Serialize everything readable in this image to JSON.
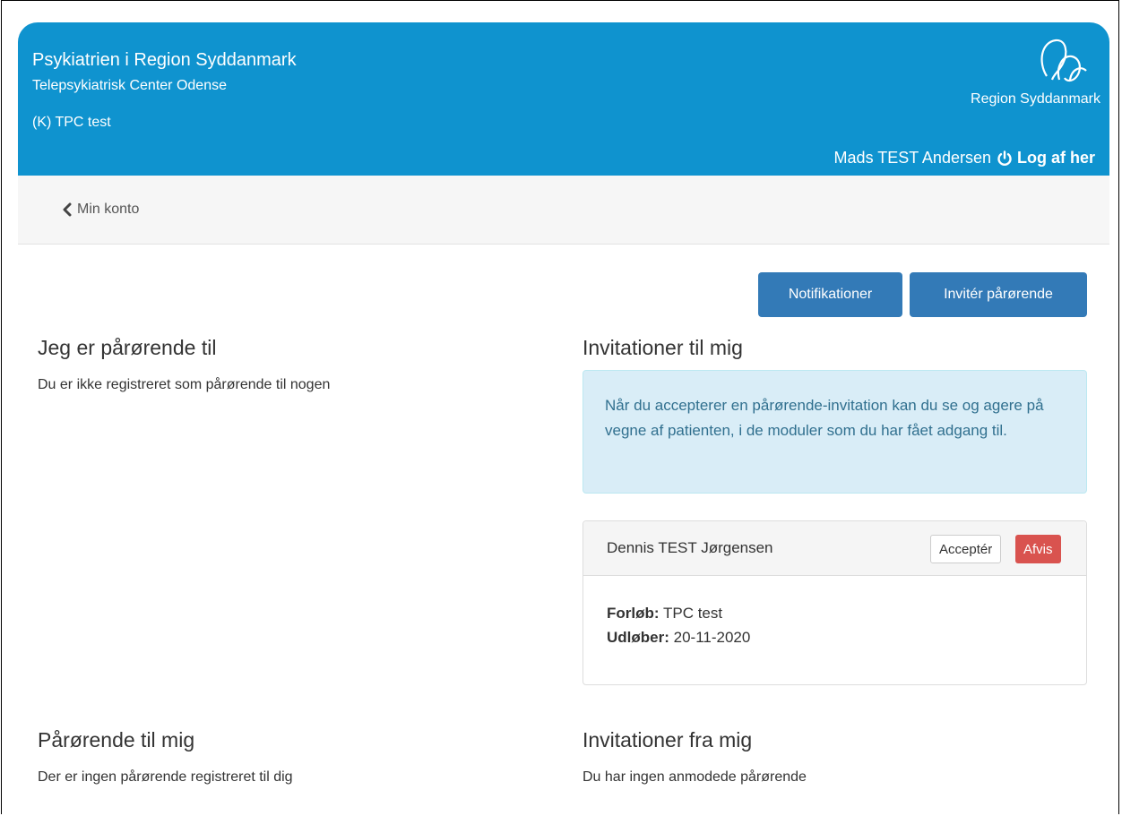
{
  "header": {
    "org_name": "Psykiatrien i Region Syddanmark",
    "org_sub": "Telepsykiatrisk Center Odense",
    "course": "(K) TPC test",
    "logo_text": "Region Syddanmark",
    "user_name": "Mads TEST Andersen",
    "logout_label": "Log af her",
    "background_color": "#0f93cf"
  },
  "subnav": {
    "back_label": "Min konto"
  },
  "actions": {
    "notifications_label": "Notifikationer",
    "invite_label": "Invitér pårørende",
    "button_color": "#337ab7"
  },
  "sections": {
    "relative_to": {
      "title": "Jeg er pårørende til",
      "text": "Du er ikke registreret som pårørende til nogen"
    },
    "invitations_to_me": {
      "title": "Invitationer til mig",
      "info": "Når du accepterer en pårørende-invitation kan du se og agere på vegne af patienten, i de moduler som du har fået adgang til.",
      "invitation": {
        "name": "Dennis TEST Jørgensen",
        "accept_label": "Acceptér",
        "reject_label": "Afvis",
        "course_label": "Forløb:",
        "course_value": "TPC test",
        "expires_label": "Udløber:",
        "expires_value": "20-11-2020"
      }
    },
    "relatives_to_me": {
      "title": "Pårørende til mig",
      "text": "Der er ingen pårørende registreret til dig"
    },
    "invitations_from_me": {
      "title": "Invitationer fra mig",
      "text": "Du har ingen anmodede pårørende"
    }
  },
  "icons": {
    "power": "power-icon",
    "back": "chevron-left-icon",
    "logo": "region-logo-icon"
  }
}
